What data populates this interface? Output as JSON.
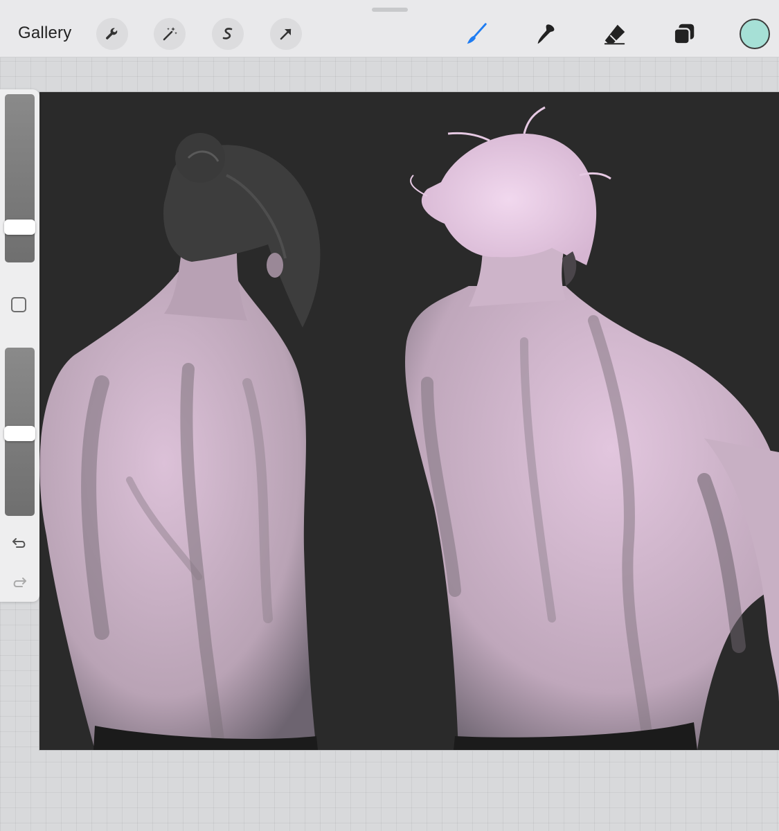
{
  "toolbar": {
    "gallery_label": "Gallery",
    "left_tools": [
      {
        "icon": "wrench-icon",
        "name": "actions"
      },
      {
        "icon": "magic-wand-icon",
        "name": "adjustments"
      },
      {
        "icon": "selection-s-icon",
        "name": "selection"
      },
      {
        "icon": "arrow-cursor-icon",
        "name": "transform"
      }
    ],
    "right_tools": [
      {
        "icon": "brush-icon",
        "name": "paint",
        "active": true,
        "color": "#1e7cf2"
      },
      {
        "icon": "smudge-icon",
        "name": "smudge"
      },
      {
        "icon": "eraser-icon",
        "name": "eraser"
      },
      {
        "icon": "layers-icon",
        "name": "layers"
      }
    ],
    "current_color": "#a6e0d6"
  },
  "sidebar": {
    "brush_size_level": 0.18,
    "opacity_level": 0.49,
    "modify_icon": "square-modify-icon",
    "undo_icon": "undo-arrow-icon",
    "redo_icon": "redo-arrow-icon"
  },
  "canvas": {
    "background_color": "#2a2a2a",
    "skin_color": "#d9bfd5",
    "hair_dark_color": "#3a3a3a",
    "hair_light_color": "#e9cbe6"
  }
}
